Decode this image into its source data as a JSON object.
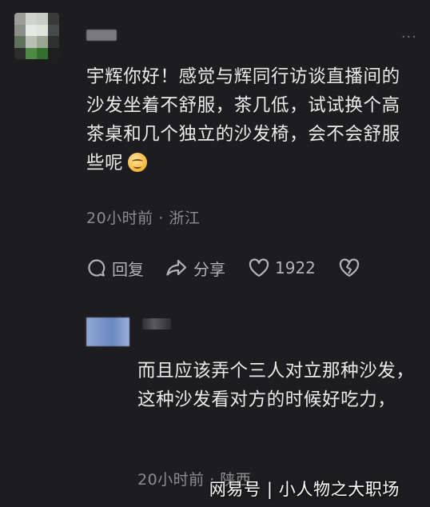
{
  "comment": {
    "text": "宇辉你好！感觉与辉同行访谈直播间的沙发坐着不舒服，茶几低，试试换个高茶桌和几个独立的沙发椅，会不会舒服些呢",
    "time": "20小时前",
    "location": "浙江",
    "meta_separator": " · ",
    "emoji_icon": "smiling-face-emoji"
  },
  "actions": {
    "reply_label": "回复",
    "share_label": "分享",
    "like_count": "1922"
  },
  "reply": {
    "text": "而且应该弄个三人对立那种沙发，这种沙发看对方的时候好吃力，",
    "time": "20小时前",
    "location": "陕西",
    "meta_separator": " · "
  },
  "watermark": "网易号 | 小人物之大职场",
  "colors": {
    "background": "#1d1c1f",
    "text": "#ebebec",
    "secondary_text": "#8d8d91",
    "action_text": "#b3b3b7"
  }
}
